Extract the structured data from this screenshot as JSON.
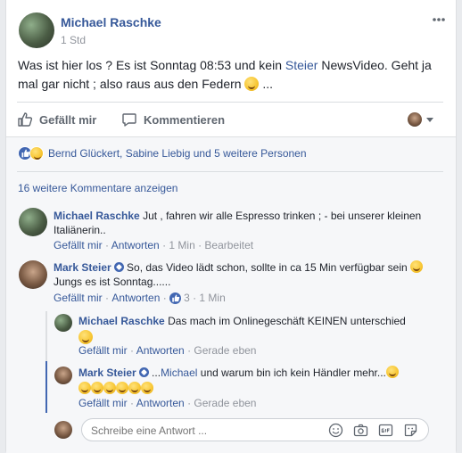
{
  "post": {
    "author": "Michael Raschke",
    "time": "1 Std",
    "text_1": "Was ist hier los ? Es ist Sonntag 08:53 und kein",
    "text_link": "Steier",
    "text_2": "NewsVideo. Geht ja",
    "text_3": "mal gar nicht ; also raus aus den Federn",
    "text_4": "..."
  },
  "actions": {
    "like": "Gefällt mir",
    "comment": "Kommentieren"
  },
  "reactions": {
    "text": "Bernd Glückert, Sabine Liebig und 5 weitere Personen"
  },
  "more_comments": "16 weitere Kommentare anzeigen",
  "comments": [
    {
      "author": "Michael Raschke",
      "text_1": "Jut , fahren wir alle Espresso trinken ; - bei unserer kleinen",
      "text_2": "Italiänerin..",
      "like": "Gefällt mir",
      "reply": "Antworten",
      "time": "1 Min",
      "edit": "Bearbeitet"
    },
    {
      "author": "Mark Steier",
      "text_1": "So, das Video lädt schon, sollte in ca 15 Min verfügbar sein",
      "text_2": "Jungs es ist Sonntag......",
      "like": "Gefällt mir",
      "reply": "Antworten",
      "like_count": "3",
      "time": "1 Min"
    }
  ],
  "replies": [
    {
      "author": "Michael Raschke",
      "text": "Das mach im Onlinegeschäft KEINEN unterschied",
      "like": "Gefällt mir",
      "reply": "Antworten",
      "time": "Gerade eben"
    },
    {
      "author": "Mark Steier",
      "text_pre": "...",
      "text_link": "Michael",
      "text_post": "und warum bin ich kein Händler mehr...",
      "like": "Gefällt mir",
      "reply": "Antworten",
      "time": "Gerade eben"
    }
  ],
  "reply_input": {
    "placeholder": "Schreibe eine Antwort ..."
  },
  "icons": {
    "more": "more-dots-icon",
    "like": "thumbs-up-icon",
    "comment": "speech-bubble-icon",
    "audience": "avatar-dropdown-icon",
    "emoji": "emoji-icon",
    "camera": "camera-icon",
    "gif": "gif-icon",
    "sticker": "sticker-icon"
  },
  "colors": {
    "link": "#365899",
    "secondary": "#90949c",
    "like_blue": "#4267b2",
    "background": "#e9ebee"
  }
}
